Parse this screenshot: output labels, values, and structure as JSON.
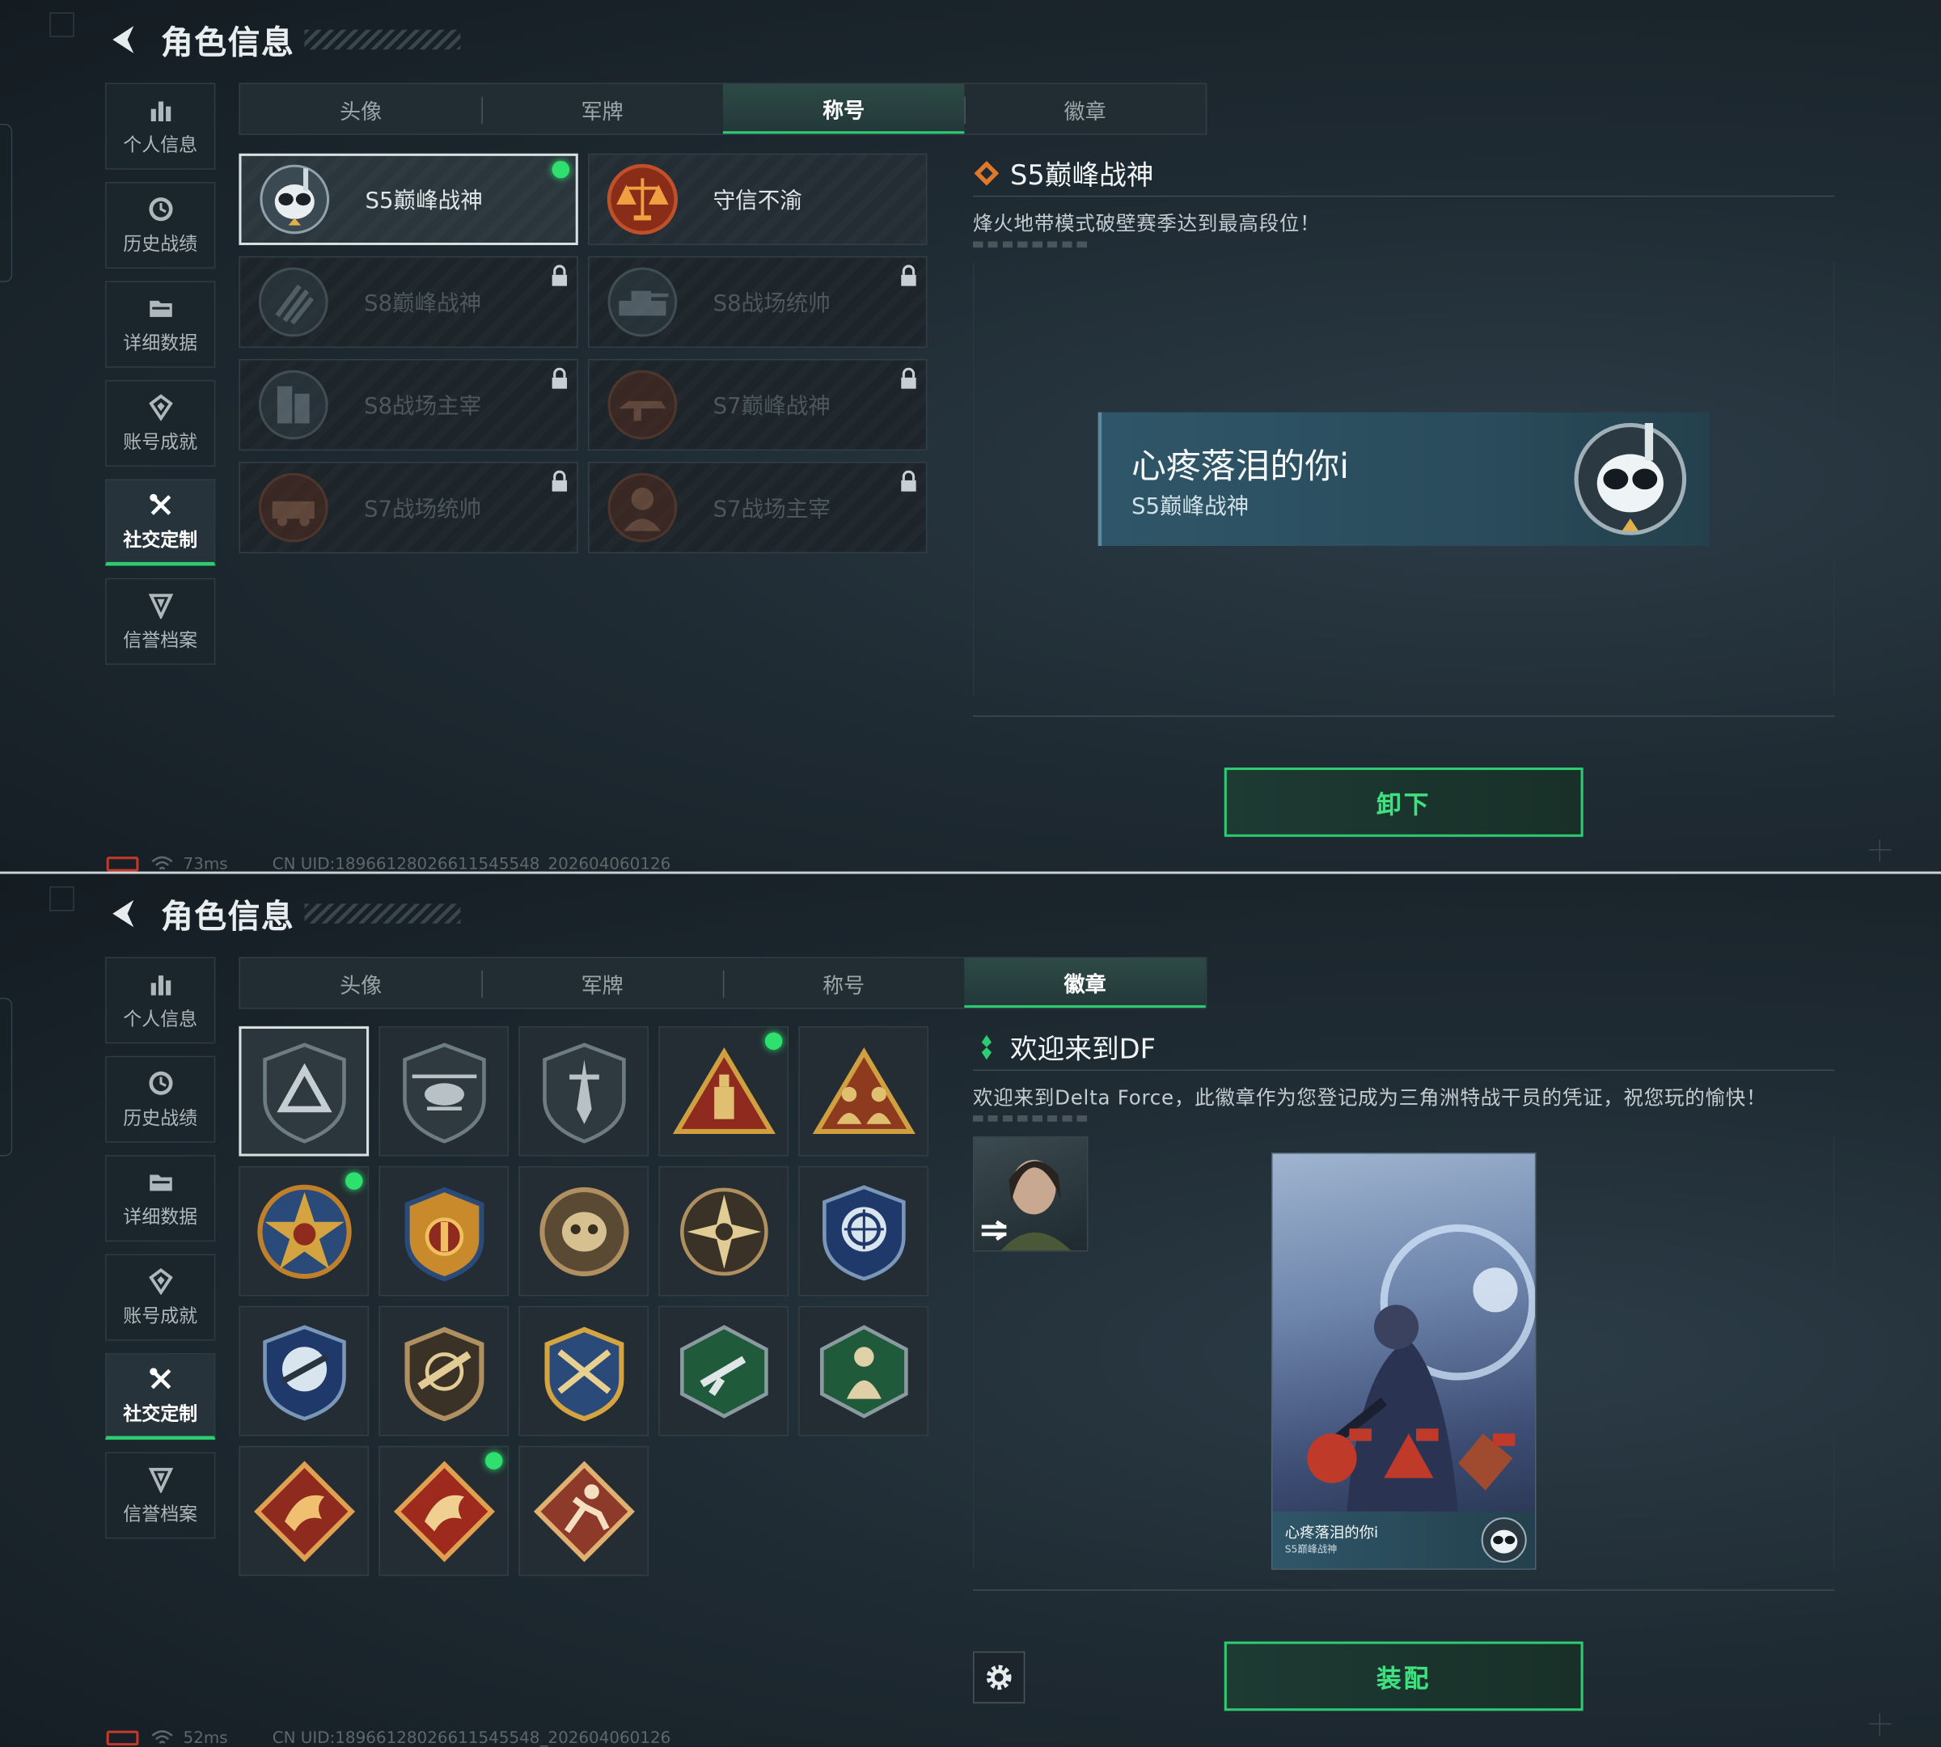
{
  "colors": {
    "accent": "#2ecc71",
    "active_dot": "#2ee06e",
    "battery": "#c0392b",
    "namecard": "#2f5668"
  },
  "screens": [
    {
      "title": "角色信息",
      "sidebar": [
        {
          "label": "个人信息",
          "icon": "bar-chart-icon"
        },
        {
          "label": "历史战绩",
          "icon": "history-clock-icon"
        },
        {
          "label": "详细数据",
          "icon": "folder-icon"
        },
        {
          "label": "账号成就",
          "icon": "achievement-icon"
        },
        {
          "label": "社交定制",
          "icon": "tools-icon",
          "active": true
        },
        {
          "label": "信誉档案",
          "icon": "shield-arrow-icon"
        }
      ],
      "tabs": [
        {
          "label": "头像"
        },
        {
          "label": "军牌"
        },
        {
          "label": "称号",
          "active": true
        },
        {
          "label": "徽章"
        }
      ],
      "titles": [
        {
          "name": "S5巅峰战神",
          "selected": true,
          "equipped": true,
          "locked": false,
          "icon": "skull-diver-emblem-icon"
        },
        {
          "name": "守信不渝",
          "selected": false,
          "equipped": false,
          "locked": false,
          "icon": "scales-emblem-icon"
        },
        {
          "name": "S8巅峰战神",
          "locked": true,
          "icon": "stripes-emblem-icon"
        },
        {
          "name": "S8战场统帅",
          "locked": true,
          "icon": "tank-emblem-icon"
        },
        {
          "name": "S8战场主宰",
          "locked": true,
          "icon": "building-emblem-icon"
        },
        {
          "name": "S7巅峰战神",
          "locked": true,
          "icon": "rifle-emblem-icon"
        },
        {
          "name": "S7战场统帅",
          "locked": true,
          "icon": "vehicle-emblem-icon"
        },
        {
          "name": "S7战场主宰",
          "locked": true,
          "icon": "soldier-emblem-icon"
        }
      ],
      "detail": {
        "title": "S5巅峰战神",
        "description": "烽火地带模式破壁赛季达到最高段位！"
      },
      "namecard": {
        "player_name": "心疼落泪的你i",
        "title": "S5巅峰战神"
      },
      "action_button": "卸下",
      "status": {
        "ping": "73ms",
        "uid": "CN UID:18966128026611545548_202604060126"
      }
    },
    {
      "title": "角色信息",
      "sidebar": [
        {
          "label": "个人信息",
          "icon": "bar-chart-icon"
        },
        {
          "label": "历史战绩",
          "icon": "history-clock-icon"
        },
        {
          "label": "详细数据",
          "icon": "folder-icon"
        },
        {
          "label": "账号成就",
          "icon": "achievement-icon"
        },
        {
          "label": "社交定制",
          "icon": "tools-icon",
          "active": true
        },
        {
          "label": "信誉档案",
          "icon": "shield-arrow-icon"
        }
      ],
      "tabs": [
        {
          "label": "头像"
        },
        {
          "label": "军牌"
        },
        {
          "label": "称号"
        },
        {
          "label": "徽章",
          "active": true
        }
      ],
      "badges": [
        {
          "icon": "delta-shield-badge-icon",
          "selected": true
        },
        {
          "icon": "helicopter-badge-icon"
        },
        {
          "icon": "dagger-shield-badge-icon"
        },
        {
          "icon": "red-triangle-tower-badge-icon",
          "equipped": true
        },
        {
          "icon": "squad-triangle-badge-icon"
        },
        {
          "icon": "star-skull-badge-icon",
          "equipped": true
        },
        {
          "icon": "gold-crest-badge-icon"
        },
        {
          "icon": "skull-crest-badge-icon"
        },
        {
          "icon": "sun-burst-badge-icon"
        },
        {
          "icon": "crosshair-blue-badge-icon"
        },
        {
          "icon": "crosshair-rifle-badge-icon"
        },
        {
          "icon": "rifle-shield-badge-icon"
        },
        {
          "icon": "crossed-rifles-badge-icon"
        },
        {
          "icon": "green-hex-gun-badge-icon"
        },
        {
          "icon": "green-hex-soldier-badge-icon"
        },
        {
          "icon": "dragon-badge-icon"
        },
        {
          "icon": "dragon-red-badge-icon",
          "equipped": true
        },
        {
          "icon": "runner-badge-icon"
        }
      ],
      "detail": {
        "title": "欢迎来到DF",
        "description": "欢迎来到Delta Force，此徽章作为您登记成为三角洲特战干员的凭证，祝您玩的愉快！"
      },
      "preview": {
        "player_name": "心疼落泪的你i",
        "title": "S5巅峰战神"
      },
      "action_button": "装配",
      "status": {
        "ping": "52ms",
        "uid": "CN UID:18966128026611545548_202604060126"
      }
    }
  ]
}
